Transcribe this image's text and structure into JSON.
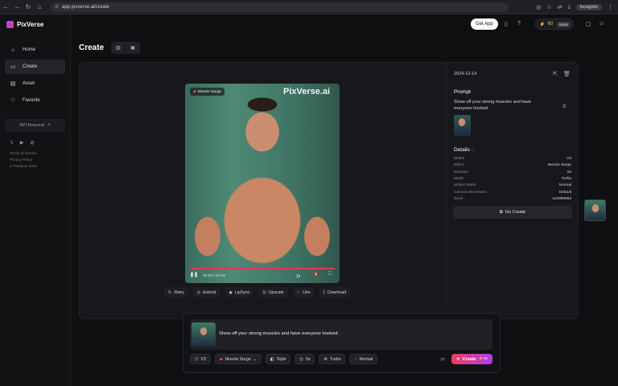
{
  "browser": {
    "url": "app.pixverse.ai/create",
    "incognito": "Incognito"
  },
  "brand": {
    "name": "PixVerse"
  },
  "sidebar": {
    "items": [
      {
        "label": "Home",
        "icon": "home-icon"
      },
      {
        "label": "Create",
        "icon": "video-icon"
      },
      {
        "label": "Asset",
        "icon": "folder-icon"
      },
      {
        "label": "Favorite",
        "icon": "heart-icon"
      }
    ],
    "api_request": "API Request",
    "footer": [
      "Terms of Service",
      "Privacy Policy",
      "© PixVerse 2024"
    ]
  },
  "topbar": {
    "get_app": "Get App",
    "credits": "60",
    "plan": "Basic"
  },
  "page": {
    "title": "Create"
  },
  "video": {
    "effect_badge": "Muscle Surge",
    "watermark": "PixVerse.ai",
    "time": "00:05 / 00:05",
    "speed": "1x",
    "progress": 1.0
  },
  "actions": [
    "Retry",
    "Extend",
    "LipSync",
    "Upscale",
    "Like",
    "Download"
  ],
  "details_panel": {
    "date": "2024-12-14",
    "prompt_heading": "Prompt",
    "prompt_text": "Show off your strong muscles and have everyone hooked.",
    "details_heading": "Details",
    "rows": [
      {
        "k": "Model",
        "v": "V3"
      },
      {
        "k": "Effect",
        "v": "Muscle Surge"
      },
      {
        "k": "Duration",
        "v": "5s"
      },
      {
        "k": "Mode",
        "v": "Turbo"
      },
      {
        "k": "Motion Mode",
        "v": "Normal"
      },
      {
        "k": "Camera Movement",
        "v": "Default"
      },
      {
        "k": "Seed",
        "v": "110096693"
      }
    ],
    "go_create": "Go Create"
  },
  "composer": {
    "prompt": "Show off your strong muscles and have everyone hooked.",
    "chips": [
      "V3",
      "Muscle Surge",
      "Style",
      "5s",
      "Turbo",
      "Normal"
    ],
    "create_label": "Create",
    "create_cost": "30"
  },
  "colors": {
    "accent_start": "#ef3e5e",
    "accent_end": "#b03cf0",
    "effect": "#e2477a"
  }
}
